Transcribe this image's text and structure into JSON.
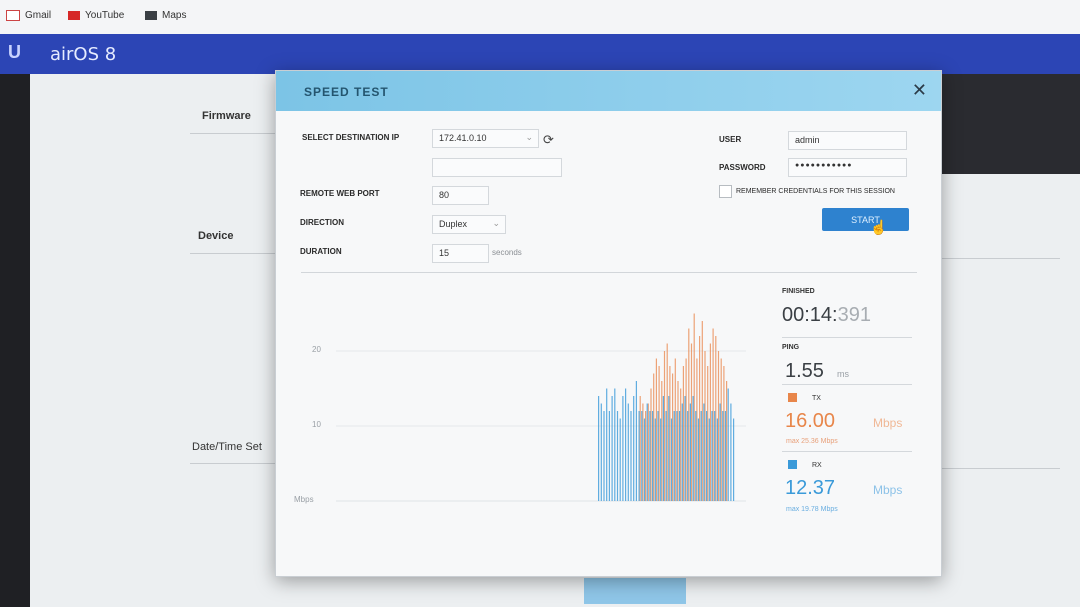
{
  "browser": {
    "bookmarks": [
      {
        "label": "Gmail",
        "icon": "gmail-icon"
      },
      {
        "label": "YouTube",
        "icon": "youtube-icon"
      },
      {
        "label": "Maps",
        "icon": "maps-icon"
      }
    ]
  },
  "app": {
    "logo": "U",
    "product": "airOS 8"
  },
  "background": {
    "firmware": "Firmware",
    "device": "Device",
    "datetime": "Date/Time Set"
  },
  "modal": {
    "title": "SPEED TEST",
    "close_icon": "close-icon",
    "labels": {
      "dest_ip": "SELECT DESTINATION IP",
      "remote_port": "REMOTE WEB PORT",
      "direction": "DIRECTION",
      "duration": "DURATION",
      "user": "USER",
      "password": "PASSWORD",
      "remember": "REMEMBER CREDENTIALS FOR THIS SESSION"
    },
    "values": {
      "dest_ip": "172.41.0.10",
      "remote_port": "80",
      "direction": "Duplex",
      "duration": "15",
      "duration_unit": "seconds",
      "user": "admin",
      "password": "●●●●●●●●●●●"
    },
    "start_label": "START",
    "results": {
      "finished_label": "FINISHED",
      "time_main": "00:14:",
      "time_ms": "391",
      "ping_label": "PING",
      "ping_value": "1.55",
      "ping_unit": "ms",
      "tx_label": "TX",
      "tx_value": "16.00",
      "tx_unit": "Mbps",
      "tx_max": "max 25.36 Mbps",
      "rx_label": "RX",
      "rx_value": "12.37",
      "rx_unit": "Mbps",
      "rx_max": "max 19.78 Mbps"
    },
    "colors": {
      "tx": "#e8864a",
      "rx": "#3a9ad9"
    }
  },
  "chart_data": {
    "type": "bar",
    "ylabel": "Mbps",
    "yticks": [
      {
        "value": 20,
        "label": "20"
      },
      {
        "value": 10,
        "label": "10"
      }
    ],
    "ylim": [
      0,
      26
    ],
    "series": [
      {
        "name": "TX",
        "values": [
          0,
          0,
          0,
          0,
          0,
          0,
          0,
          0,
          0,
          0,
          0,
          0,
          0,
          0,
          0,
          14,
          13,
          12,
          13,
          15,
          17,
          19,
          18,
          16,
          20,
          21,
          18,
          17,
          19,
          16,
          15,
          18,
          19,
          23,
          21,
          25,
          19,
          22,
          24,
          20,
          18,
          21,
          23,
          22,
          20,
          19,
          18,
          16,
          0,
          0,
          0
        ]
      },
      {
        "name": "RX",
        "values": [
          14,
          13,
          12,
          15,
          12,
          14,
          15,
          12,
          11,
          14,
          15,
          13,
          12,
          14,
          16,
          12,
          12,
          11,
          13,
          12,
          12,
          11,
          12,
          11,
          14,
          12,
          14,
          11,
          12,
          12,
          12,
          13,
          14,
          12,
          13,
          14,
          12,
          11,
          12,
          13,
          12,
          11,
          12,
          12,
          11,
          13,
          12,
          12,
          15,
          13,
          11
        ]
      }
    ]
  }
}
